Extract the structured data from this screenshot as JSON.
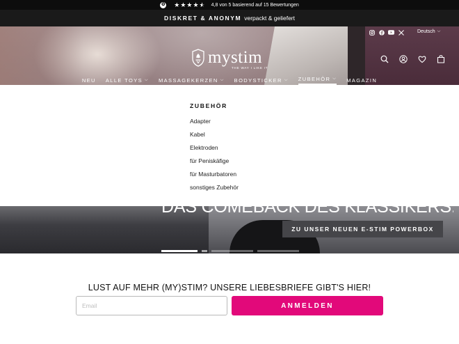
{
  "rating_bar": {
    "badge": "✪",
    "text": "4,8 von 5 basierend auf 15 Bewertungen",
    "stars": [
      "★",
      "★",
      "★",
      "★",
      "★"
    ],
    "rating_value": 4.8,
    "rating_max": 5
  },
  "discreet_bar": {
    "strong": "DISKRET & ANONYM",
    "rest": "verpackt & geliefert"
  },
  "header": {
    "social": [
      "instagram-icon",
      "facebook-icon",
      "youtube-icon",
      "x-icon"
    ],
    "language": "Deutsch",
    "logo_text": "mystim",
    "logo_tagline": "THE WAY I LIKE IT",
    "actions": [
      "search-icon",
      "account-icon",
      "heart-icon",
      "cart-icon"
    ],
    "nav": [
      {
        "label": "NEU",
        "dropdown": false
      },
      {
        "label": "ALLE TOYS",
        "dropdown": true
      },
      {
        "label": "MASSAGEKERZEN",
        "dropdown": true
      },
      {
        "label": "BODYSTICKER",
        "dropdown": true
      },
      {
        "label": "ZUBEHÖR",
        "dropdown": true,
        "active": true
      },
      {
        "label": "MAGAZIN",
        "dropdown": false
      }
    ]
  },
  "dropdown": {
    "title": "ZUBEHÖR",
    "items": [
      "Adapter",
      "Kabel",
      "Elektroden",
      "für Peniskäfige",
      "für Masturbatoren",
      "sonstiges Zubehör"
    ]
  },
  "hero": {
    "headline": "DAS COMEBACK DES KLASSIKERS.",
    "cta": "ZU UNSER NEUEN E-STIM POWERBOX"
  },
  "newsletter": {
    "title": "LUST AUF MEHR (MY)STIM? UNSERE LIEBESBRIEFE GIBT'S HIER!",
    "email_placeholder": "Email",
    "button": "ANMELDEN"
  },
  "colors": {
    "accent": "#e2097a",
    "bar_dark": "#0d0d0d",
    "cta_bg": "#454549"
  }
}
